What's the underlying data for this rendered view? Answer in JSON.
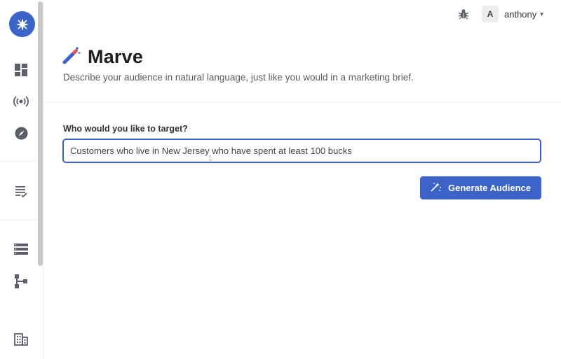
{
  "sidebar": {
    "logo_icon": "sparkle-logo-icon",
    "items": [
      {
        "icon": "dashboard-icon"
      },
      {
        "icon": "broadcast-icon"
      },
      {
        "icon": "compass-icon"
      },
      {
        "icon": "checklist-icon"
      },
      {
        "icon": "list-stack-icon"
      },
      {
        "icon": "hierarchy-icon"
      },
      {
        "icon": "building-icon"
      }
    ]
  },
  "topbar": {
    "bug_icon": "bug-icon",
    "user": {
      "avatar_letter": "A",
      "name": "anthony",
      "caret": "⌄"
    }
  },
  "page": {
    "title": "Marve",
    "title_icon": "magic-wand-icon",
    "subtitle": "Describe your audience in natural language, just like you would in a marketing brief."
  },
  "form": {
    "label": "Who would you like to target?",
    "input_value": "Customers who live in New Jersey who have spent at least 100 bucks",
    "button_label": "Generate Audience",
    "button_icon": "sparkles-icon"
  },
  "colors": {
    "accent": "#3b63c8",
    "wand": "#3b63c8",
    "wand_tip": "#e0565b"
  }
}
